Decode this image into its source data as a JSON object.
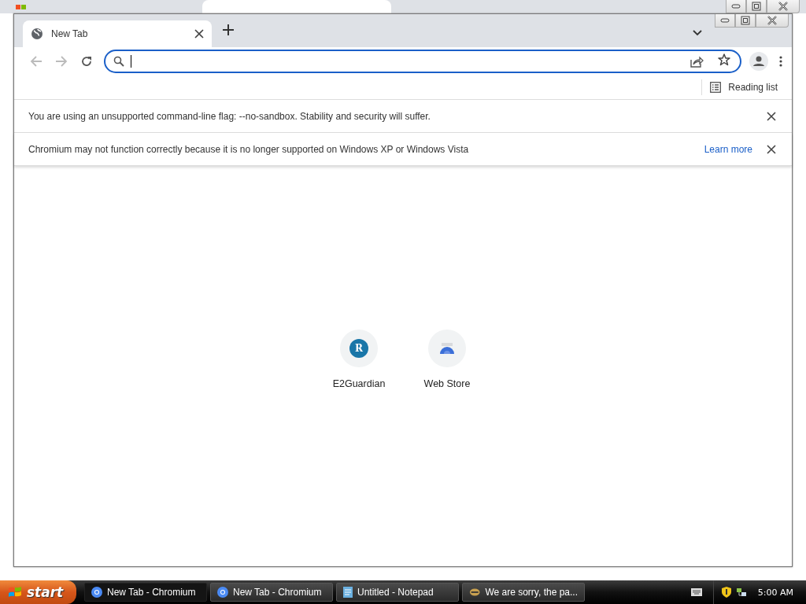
{
  "browser": {
    "tabs": [
      {
        "title": "New Tab",
        "selected": true
      }
    ],
    "address_bar": {
      "focused": true
    },
    "bookmarks_bar": {
      "reading_list": "Reading list"
    },
    "infobars": [
      {
        "message": "You are using an unsupported command-line flag: --no-sandbox. Stability and security will suffer."
      },
      {
        "message": "Chromium may not function correctly because it is no longer supported on Windows XP or Windows Vista",
        "link": "Learn more"
      }
    ],
    "shortcuts": [
      {
        "kind": "letter",
        "letter": "R",
        "label": "E2Guardian"
      },
      {
        "kind": "store",
        "label": "Web Store"
      }
    ]
  },
  "taskbar": {
    "start": "start",
    "tasks": [
      {
        "label": "New Tab - Chromium",
        "kind": "chromium",
        "selected": true
      },
      {
        "label": "New Tab - Chromium",
        "kind": "chromium",
        "selected": false
      },
      {
        "label": "Untitled - Notepad",
        "kind": "notepad",
        "selected": false
      },
      {
        "label": "We are sorry, the pa...",
        "kind": "error",
        "selected": false
      }
    ],
    "clock": "5:00 AM"
  }
}
